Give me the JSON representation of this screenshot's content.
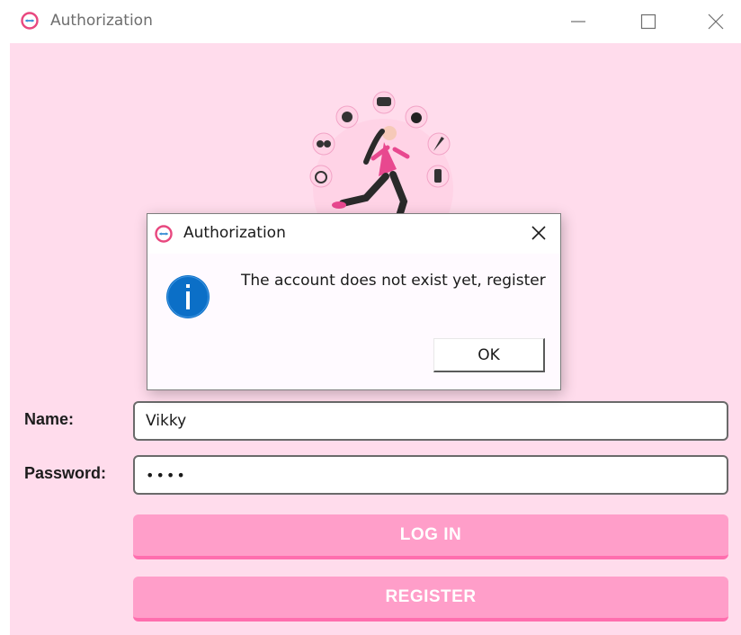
{
  "window": {
    "title": "Authorization",
    "controls": [
      "minimize-icon",
      "maximize-icon",
      "close-icon"
    ]
  },
  "form": {
    "name_label": "Name:",
    "name_value": "Vikky",
    "password_label": "Password:",
    "password_value": "••••",
    "login_label": "LOG IN",
    "register_label": "REGISTER"
  },
  "dialog": {
    "title": "Authorization",
    "message": "The account does not exist yet, register",
    "ok_label": "OK",
    "icon": "info-icon"
  },
  "colors": {
    "background": "#ffdcec",
    "button": "#ff9ec9",
    "button_edge": "#ff6eae",
    "accent": "#e83e8c",
    "info_blue": "#0b6fc7"
  }
}
